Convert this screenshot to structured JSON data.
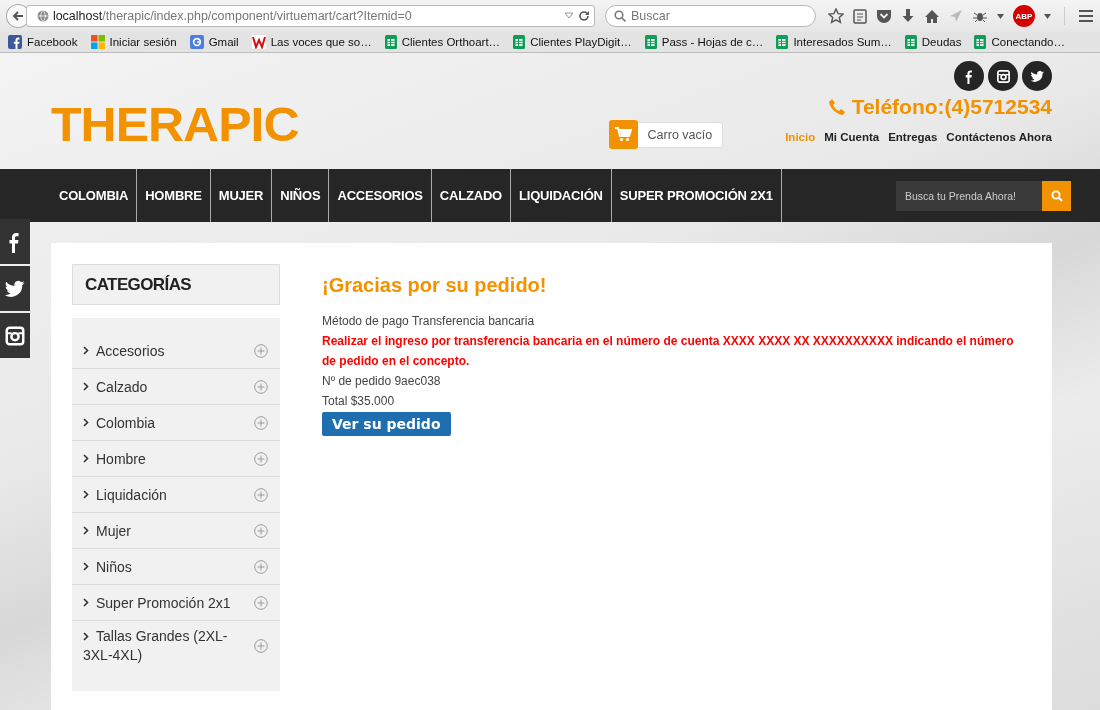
{
  "browser": {
    "url_host": "localhost",
    "url_path": "/therapic/index.php/component/virtuemart/cart?Itemid=0",
    "search_placeholder": "Buscar",
    "abp_label": "ABP",
    "bookmarks": [
      {
        "label": "Facebook",
        "kind": "facebook"
      },
      {
        "label": "Iniciar sesión",
        "kind": "windows"
      },
      {
        "label": "Gmail",
        "kind": "google"
      },
      {
        "label": "Las voces que so…",
        "kind": "wikia"
      },
      {
        "label": "Clientes Orthoart…",
        "kind": "sheet"
      },
      {
        "label": "Clientes PlayDigit…",
        "kind": "sheet"
      },
      {
        "label": "Pass - Hojas de c…",
        "kind": "sheet"
      },
      {
        "label": "Interesados Sum…",
        "kind": "sheet"
      },
      {
        "label": "Deudas",
        "kind": "sheet"
      },
      {
        "label": "Conectando…",
        "kind": "sheet"
      }
    ]
  },
  "header": {
    "logo": "THERAPIC",
    "cart_label": "Carro vacío",
    "phone": "Teléfono:(4)5712534",
    "top_links": [
      {
        "label": "Inicio",
        "selected": true
      },
      {
        "label": "Mi Cuenta",
        "selected": false
      },
      {
        "label": "Entregas",
        "selected": false
      },
      {
        "label": "Contáctenos Ahora",
        "selected": false
      }
    ]
  },
  "nav": {
    "items": [
      "COLOMBIA",
      "HOMBRE",
      "MUJER",
      "NIÑOS",
      "ACCESORIOS",
      "CALZADO",
      "LIQUIDACIÓN",
      "SUPER PROMOCIÓN 2X1"
    ],
    "search_placeholder": "Busca tu Prenda Ahora!"
  },
  "sidebar": {
    "title": "CATEGORÍAS",
    "categories": [
      "Accesorios",
      "Calzado",
      "Colombia",
      "Hombre",
      "Liquidación",
      "Mujer",
      "Niños",
      "Super Promoción 2x1",
      "Tallas Grandes (2XL-3XL-4XL)"
    ]
  },
  "order": {
    "title": "¡Gracias por su pedido!",
    "payment_label": "Método de pago",
    "payment_value": "Transferencia bancaria",
    "instructions": "Realizar el ingreso por transferencia bancaria en el número de cuenta XXXX XXXX XX XXXXXXXXXX indicando el número de pedido en el concepto.",
    "order_number": "Nº de pedido 9aec038",
    "total": "Total $35.000",
    "button": "Ver su pedido"
  }
}
